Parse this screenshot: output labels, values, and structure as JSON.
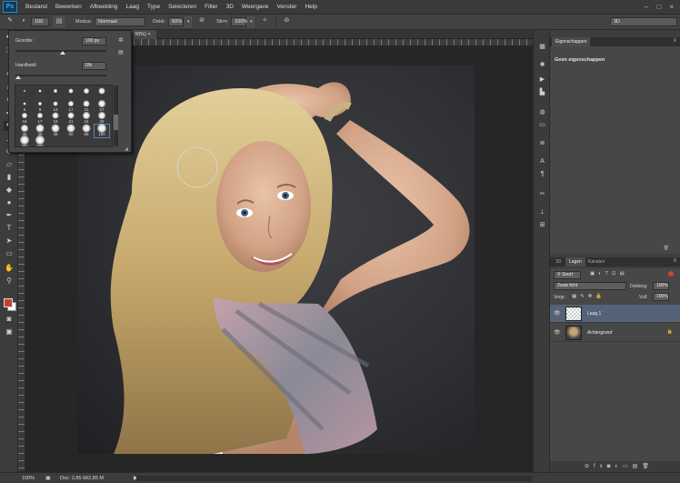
{
  "app": {
    "logo": "Ps"
  },
  "menubar": {
    "items": [
      "Bestand",
      "Bewerken",
      "Afbeelding",
      "Laag",
      "Type",
      "Selecteren",
      "Filter",
      "3D",
      "Weergave",
      "Venster",
      "Help"
    ]
  },
  "options_bar": {
    "brush_size": "100",
    "mode_label": "Modus:",
    "mode_value": "Normaal",
    "opacity_label": "Dekk:",
    "opacity_value": "60%",
    "flow_label": "Strm:",
    "flow_value": "100%",
    "workspace": "3D"
  },
  "document_tab": {
    "label": "00%)"
  },
  "brush_panel": {
    "size_label": "Grootte:",
    "size_value": "100 px",
    "hardness_label": "Hardheid:",
    "hardness_value": "0%",
    "size_fraction": 0.52,
    "hardness_fraction": 0.0,
    "presets": [
      {
        "label": "",
        "d": 2
      },
      {
        "label": "",
        "d": 3
      },
      {
        "label": "",
        "d": 4
      },
      {
        "label": "",
        "d": 5
      },
      {
        "label": "",
        "d": 6
      },
      {
        "label": "",
        "d": 7
      },
      {
        "label": "5",
        "d": 3
      },
      {
        "label": "9",
        "d": 4
      },
      {
        "label": "13",
        "d": 5
      },
      {
        "label": "17",
        "d": 6
      },
      {
        "label": "21",
        "d": 7
      },
      {
        "label": "27",
        "d": 8
      },
      {
        "label": "16",
        "d": 6
      },
      {
        "label": "17",
        "d": 6
      },
      {
        "label": "18",
        "d": 7
      },
      {
        "label": "21",
        "d": 7
      },
      {
        "label": "24",
        "d": 8
      },
      {
        "label": "28",
        "d": 8
      },
      {
        "label": "35",
        "d": 8
      },
      {
        "label": "45",
        "d": 9
      },
      {
        "label": "48",
        "d": 9
      },
      {
        "label": "60",
        "d": 9
      },
      {
        "label": "65",
        "d": 9
      },
      {
        "label": "100",
        "d": 10
      },
      {
        "label": "300",
        "d": 10
      },
      {
        "label": "500",
        "d": 10
      }
    ]
  },
  "properties_panel": {
    "tabs": [
      "Eigenschappen"
    ],
    "empty_text": "Geen eigenschappen"
  },
  "layers_panel": {
    "tabs": [
      "3D",
      "Lagen",
      "Kanalen"
    ],
    "filter": "Soort",
    "blend_mode": "Zwak licht",
    "opacity_label": "Dekking:",
    "opacity_value": "100%",
    "lock_label": "Vergr.:",
    "fill_label": "Vull:",
    "fill_value": "100%",
    "layers": [
      {
        "name": "Laag 1",
        "selected": true,
        "italic": false,
        "locked": false,
        "thumb": "transparent"
      },
      {
        "name": "Achtergrond",
        "selected": false,
        "italic": true,
        "locked": true,
        "thumb": "photo"
      }
    ]
  },
  "status_bar": {
    "zoom": "100%",
    "doc_size": "Doc: 2,85 M/2,85 M"
  },
  "colors": {
    "foreground": "#c8412a",
    "background": "#ffffff",
    "accent_selected": "#546378"
  }
}
